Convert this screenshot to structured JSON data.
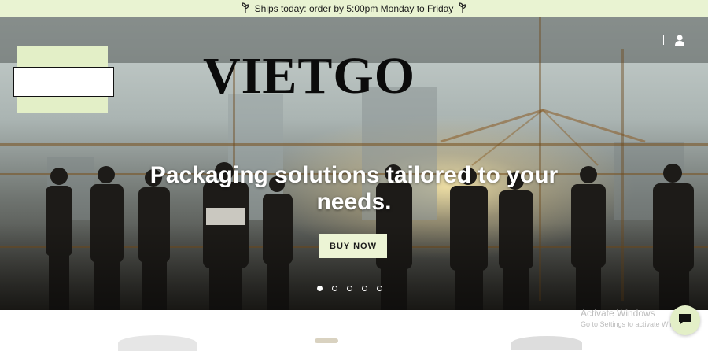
{
  "announcement": {
    "text": "Ships today: order by 5:00pm Monday to Friday",
    "icon": "leaf-icon"
  },
  "brand": {
    "name": "VIETGO"
  },
  "header": {
    "account_icon": "user-icon"
  },
  "hero": {
    "headline": "Packaging solutions tailored to your needs.",
    "cta_label": "BUY NOW",
    "slides_total": 5,
    "active_slide": 1
  },
  "chat": {
    "icon": "chat-bubble-icon"
  },
  "watermark": {
    "title": "Activate Windows",
    "subtitle": "Go to Settings to activate Windows."
  },
  "colors": {
    "accent": "#e3efc7",
    "announcement_bg": "#e9f3d2",
    "headline": "#ffffff"
  }
}
